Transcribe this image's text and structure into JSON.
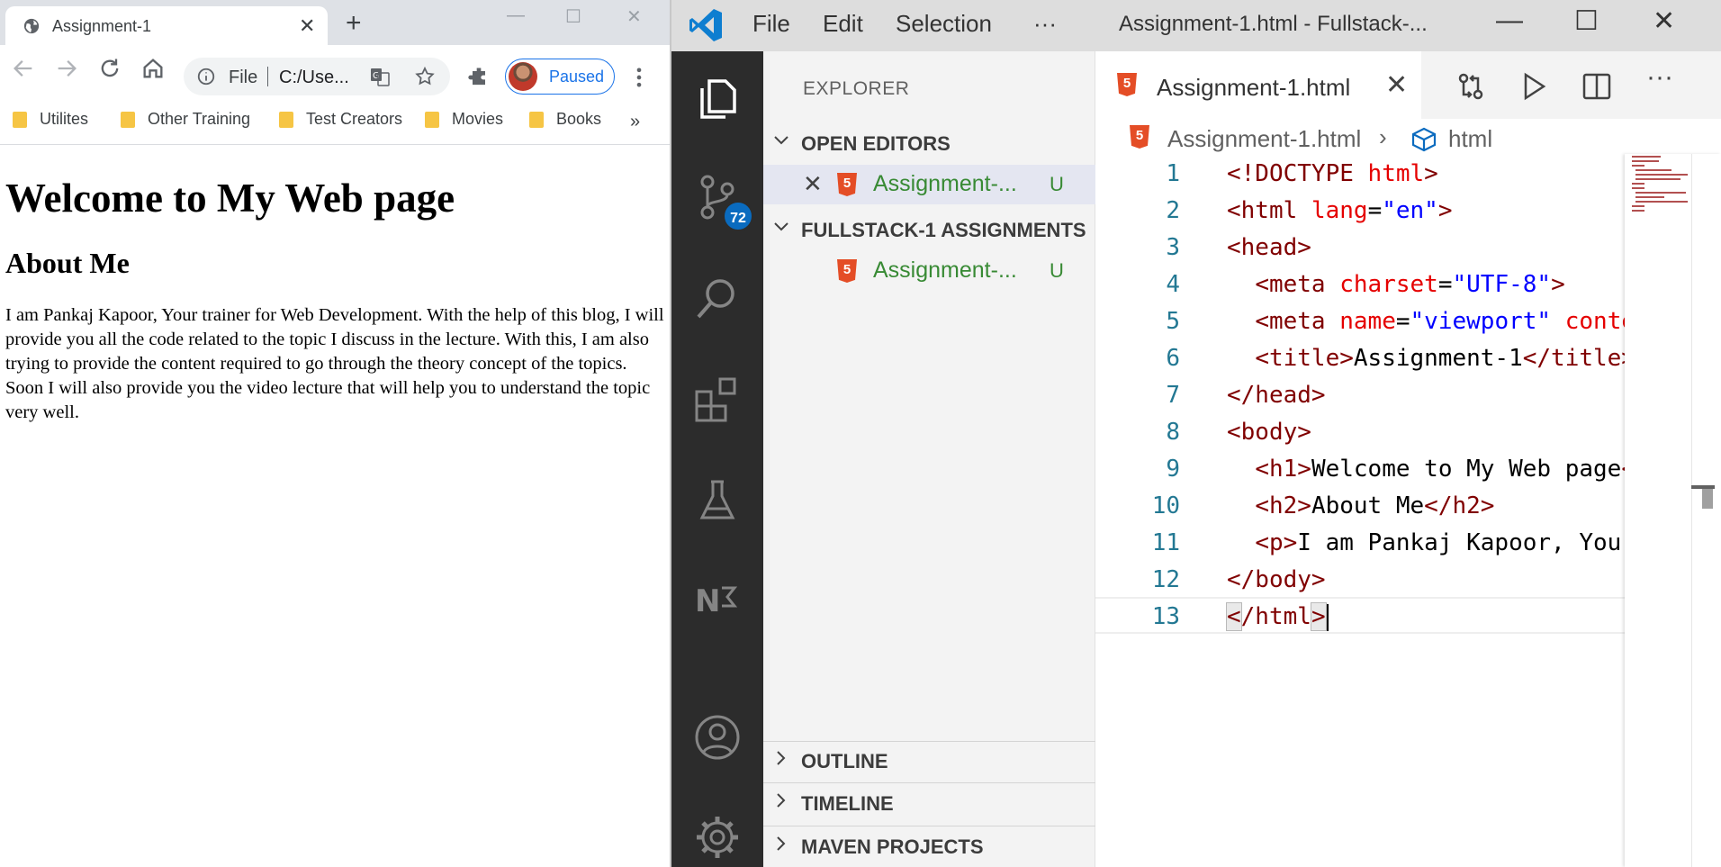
{
  "browser": {
    "tab_title": "Assignment-1",
    "new_tab_symbol": "+",
    "address": {
      "scheme_label": "File",
      "url": "C:/Use..."
    },
    "profile_status": "Paused",
    "bookmarks": [
      "Utilites",
      "Other Training",
      "Test Creators",
      "Movies",
      "Books"
    ],
    "bookmarks_more": "»",
    "page": {
      "h1": "Welcome to My Web page",
      "h2": "About Me",
      "paragraph": "I am Pankaj Kapoor, Your trainer for Web Development. With the help of this blog, I will provide you all the code related to the topic I discuss in the lecture. With this, I am also trying to provide the content required to go through the theory concept of the topics. Soon I will also provide you the video lecture that will help you to understand the topic very well."
    },
    "icons": [
      "globe-icon",
      "back-icon",
      "forward-icon",
      "reload-icon",
      "home-icon",
      "info-icon",
      "translate-icon",
      "star-icon",
      "extensions-icon",
      "more-vert-icon",
      "folder-icon"
    ]
  },
  "vscode": {
    "menu": [
      "File",
      "Edit",
      "Selection",
      "···"
    ],
    "window_title": "Assignment-1.html - Fullstack-...",
    "activity_badge": "72",
    "explorer": {
      "title": "EXPLORER",
      "open_editors_label": "OPEN EDITORS",
      "workspace_label": "FULLSTACK-1 ASSIGNMENTS",
      "open_file": {
        "name": "Assignment-...",
        "status": "U"
      },
      "workspace_file": {
        "name": "Assignment-...",
        "status": "U"
      },
      "bottom_sections": [
        "OUTLINE",
        "TIMELINE",
        "MAVEN PROJECTS"
      ]
    },
    "editor": {
      "tab_label": "Assignment-1.html",
      "breadcrumb": {
        "file": "Assignment-1.html",
        "symbol": "html"
      },
      "line_numbers": [
        "1",
        "2",
        "3",
        "4",
        "5",
        "6",
        "7",
        "8",
        "9",
        "10",
        "11",
        "12",
        "13"
      ]
    },
    "colors": {
      "activity_bar": "#2c2c2c",
      "accent_blue": "#0a6bbf",
      "git_untracked": "#388a34",
      "html_icon": "#e44d26"
    }
  }
}
